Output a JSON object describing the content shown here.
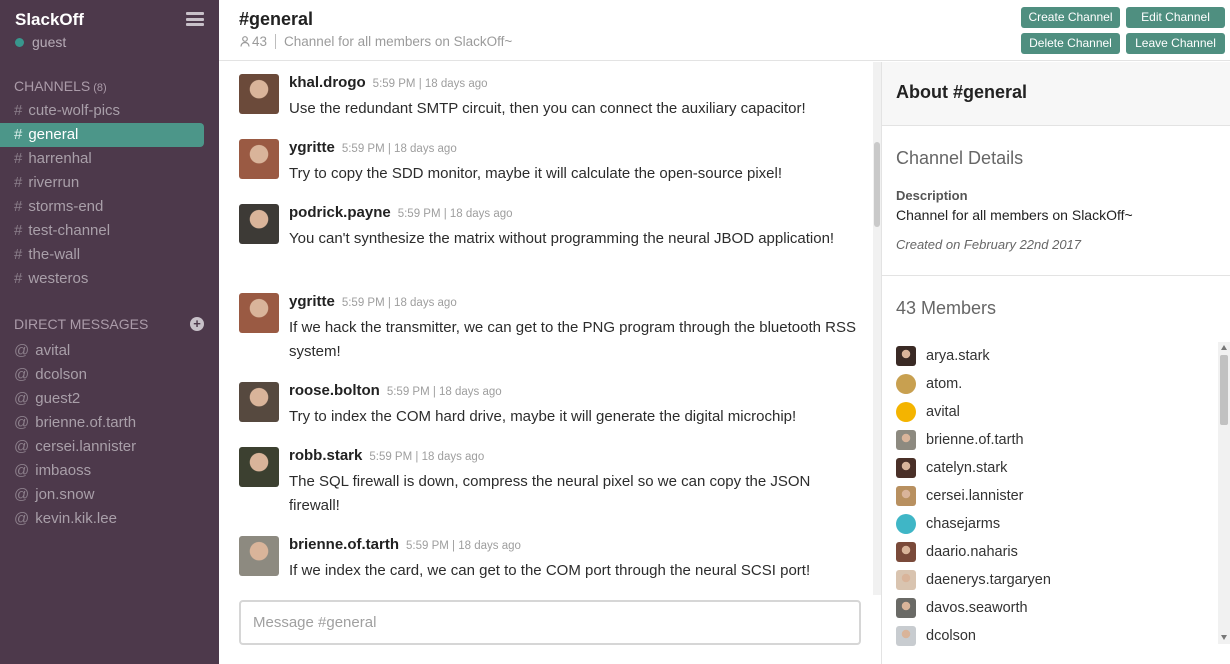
{
  "sidebar": {
    "brand": "SlackOff",
    "user_status": "guest",
    "channels_heading": "CHANNELS",
    "channels_count": "(8)",
    "channels": [
      "cute-wolf-pics",
      "general",
      "harrenhal",
      "riverrun",
      "storms-end",
      "test-channel",
      "the-wall",
      "westeros"
    ],
    "active_channel": "general",
    "dm_heading": "DIRECT MESSAGES",
    "direct_messages": [
      "avital",
      "dcolson",
      "guest2",
      "brienne.of.tarth",
      "cersei.lannister",
      "imbaoss",
      "jon.snow",
      "kevin.kik.lee"
    ],
    "channel_prefix": "#",
    "dm_prefix": "@"
  },
  "header": {
    "title": "#general",
    "member_count": "43",
    "description": "Channel for all members on SlackOff~",
    "buttons": {
      "create": "Create Channel",
      "edit": "Edit Channel",
      "delete": "Delete Channel",
      "leave": "Leave Channel"
    }
  },
  "messages": [
    {
      "user": "khal.drogo",
      "time": "5:59 PM | 18 days ago",
      "text": "Use the redundant SMTP circuit, then you can connect the auxiliary capacitor!",
      "avatar_color": "#6b4a3a"
    },
    {
      "user": "ygritte",
      "time": "5:59 PM | 18 days ago",
      "text": "Try to copy the SDD monitor, maybe it will calculate the open-source pixel!",
      "avatar_color": "#9a5a43"
    },
    {
      "user": "podrick.payne",
      "time": "5:59 PM | 18 days ago",
      "text": "You can't synthesize the matrix without programming the neural JBOD application!",
      "avatar_color": "#3d3a36"
    },
    {
      "user": "ygritte",
      "time": "5:59 PM | 18 days ago",
      "text": "If we hack the transmitter, we can get to the PNG program through the bluetooth RSS system!",
      "avatar_color": "#9a5a43"
    },
    {
      "user": "roose.bolton",
      "time": "5:59 PM | 18 days ago",
      "text": "Try to index the COM hard drive, maybe it will generate the digital microchip!",
      "avatar_color": "#56493f"
    },
    {
      "user": "robb.stark",
      "time": "5:59 PM | 18 days ago",
      "text": "The SQL firewall is down, compress the neural pixel so we can copy the JSON firewall!",
      "avatar_color": "#3c4030"
    },
    {
      "user": "brienne.of.tarth",
      "time": "5:59 PM | 18 days ago",
      "text": "If we index the card, we can get to the COM port through the neural SCSI port!",
      "avatar_color": "#8d8a80"
    }
  ],
  "composer": {
    "placeholder": "Message #general"
  },
  "panel": {
    "about_title": "About #general",
    "details_title": "Channel Details",
    "description_label": "Description",
    "description": "Channel for all members on SlackOff~",
    "created": "Created on February 22nd 2017",
    "members_title": "43 Members",
    "members": [
      {
        "name": "arya.stark",
        "color": "#3a2a25"
      },
      {
        "name": "atom.",
        "color": "#c8a050"
      },
      {
        "name": "avital",
        "color": "#f4b400"
      },
      {
        "name": "brienne.of.tarth",
        "color": "#8d8a80"
      },
      {
        "name": "catelyn.stark",
        "color": "#4a3028"
      },
      {
        "name": "cersei.lannister",
        "color": "#b89060"
      },
      {
        "name": "chasejarms",
        "color": "#3fb6c6"
      },
      {
        "name": "daario.naharis",
        "color": "#7a4a3a"
      },
      {
        "name": "daenerys.targaryen",
        "color": "#d9c4b0"
      },
      {
        "name": "davos.seaworth",
        "color": "#6a6a66"
      },
      {
        "name": "dcolson",
        "color": "#c8ccd0"
      }
    ]
  },
  "colors": {
    "sidebar_bg": "#4d394b",
    "accent": "#4c9689",
    "button": "#4f8f80"
  }
}
